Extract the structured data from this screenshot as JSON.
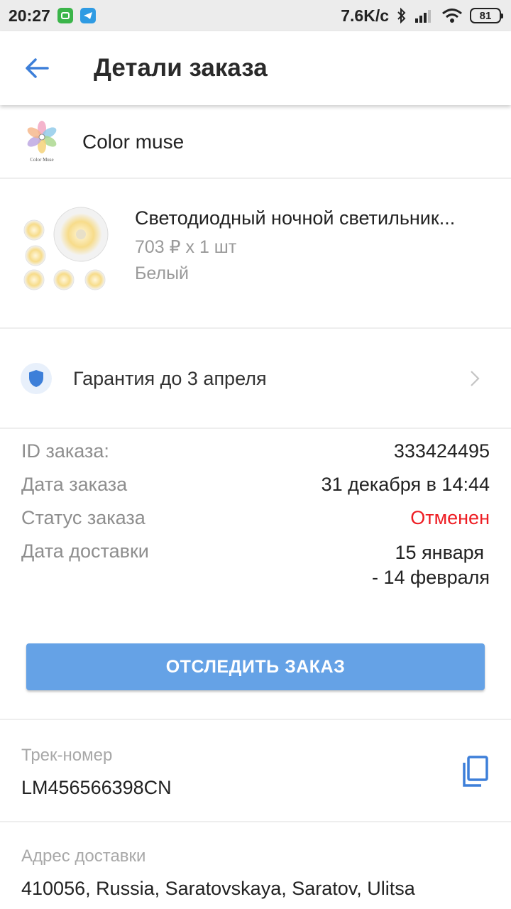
{
  "status_bar": {
    "time": "20:27",
    "network_speed": "7.6K/с",
    "battery": "81"
  },
  "header": {
    "title": "Детали заказа",
    "back_icon": "arrow-left-icon"
  },
  "store": {
    "name": "Color muse",
    "logo_text": "Color Muse"
  },
  "product": {
    "name": "Светодиодный ночной светильник...",
    "price": "703 ₽ x 1 шт",
    "color": "Белый"
  },
  "warranty": {
    "text": "Гарантия до 3 апреля",
    "icon": "shield-icon"
  },
  "details": {
    "order_id_label": "ID заказа:",
    "order_id_value": "333424495",
    "order_date_label": "Дата заказа",
    "order_date_value": "31 декабря в 14:44",
    "status_label": "Статус заказа",
    "status_value": "Отменен",
    "delivery_label": "Дата доставки",
    "delivery_value_line1": "15 января",
    "delivery_value_line2": "- 14 февраля"
  },
  "track_button": {
    "label": "ОТСЛЕДИТЬ ЗАКАЗ"
  },
  "tracking": {
    "label": "Трек-номер",
    "number": "LM456566398CN"
  },
  "address": {
    "label": "Адрес доставки",
    "value": "410056, Russia, Saratovskaya, Saratov, Ulitsa"
  },
  "colors": {
    "accent": "#65a2e6",
    "status_cancelled": "#ee1d23",
    "icon_blue": "#3d7fd9"
  }
}
